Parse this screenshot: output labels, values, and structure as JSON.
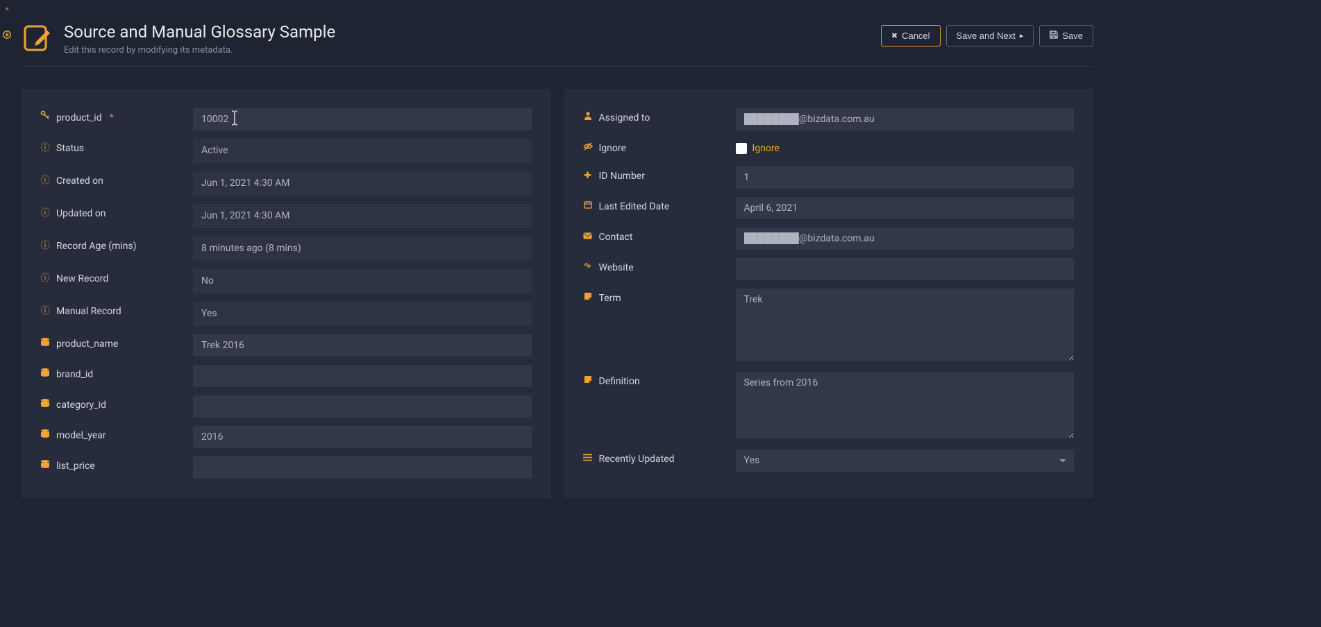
{
  "header": {
    "title": "Source and Manual Glossary Sample",
    "subtitle": "Edit this record by modifying its metadata.",
    "cancel": "Cancel",
    "saveNext": "Save and Next",
    "save": "Save"
  },
  "leftFields": {
    "product_id": {
      "label": "product_id",
      "value": "10002",
      "required": true
    },
    "status": {
      "label": "Status",
      "value": "Active"
    },
    "created_on": {
      "label": "Created on",
      "value": "Jun 1, 2021 4:30 AM"
    },
    "updated_on": {
      "label": "Updated on",
      "value": "Jun 1, 2021 4:30 AM"
    },
    "record_age": {
      "label": "Record Age (mins)",
      "value": "8 minutes ago (8 mins)"
    },
    "new_record": {
      "label": "New Record",
      "value": "No"
    },
    "manual_record": {
      "label": "Manual Record",
      "value": "Yes"
    },
    "product_name": {
      "label": "product_name",
      "value": "Trek 2016"
    },
    "brand_id": {
      "label": "brand_id",
      "value": ""
    },
    "category_id": {
      "label": "category_id",
      "value": ""
    },
    "model_year": {
      "label": "model_year",
      "value": "2016"
    },
    "list_price": {
      "label": "list_price",
      "value": ""
    }
  },
  "rightFields": {
    "assigned_to": {
      "label": "Assigned to",
      "value": "████████@bizdata.com.au"
    },
    "ignore": {
      "label": "Ignore",
      "checkboxLabel": "Ignore"
    },
    "id_number": {
      "label": "ID Number",
      "value": "1"
    },
    "last_edited": {
      "label": "Last Edited Date",
      "value": "April 6, 2021"
    },
    "contact": {
      "label": "Contact",
      "value": "████████@bizdata.com.au"
    },
    "website": {
      "label": "Website",
      "value": ""
    },
    "term": {
      "label": "Term",
      "value": "Trek"
    },
    "definition": {
      "label": "Definition",
      "value": "Series from 2016"
    },
    "recently_updated": {
      "label": "Recently Updated",
      "value": "Yes"
    }
  }
}
